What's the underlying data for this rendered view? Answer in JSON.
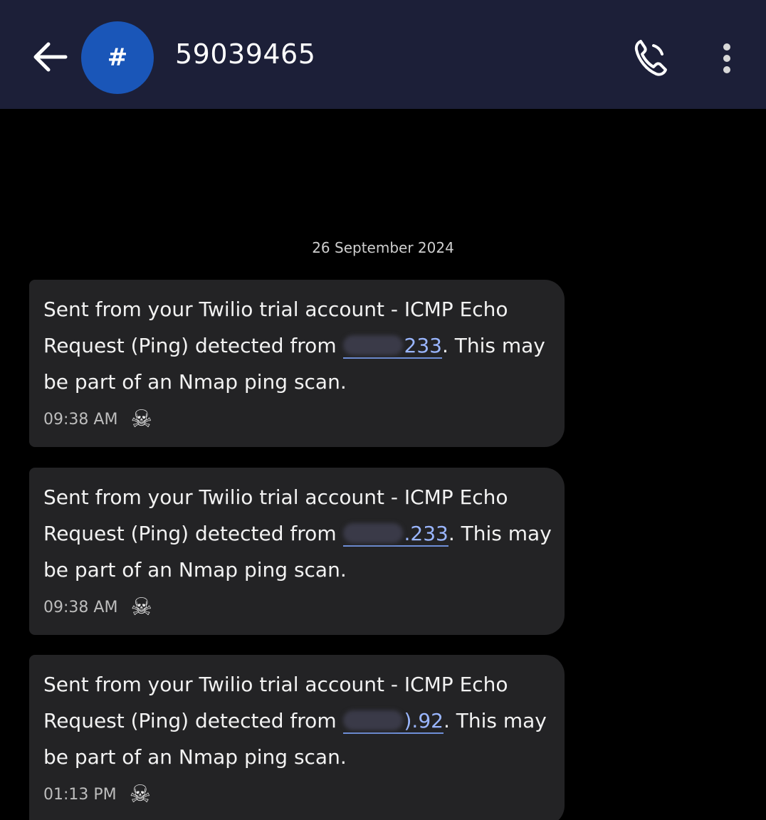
{
  "header": {
    "avatar_label": "#",
    "contact_number": "59039465"
  },
  "conversation": {
    "date_separator": "26 September 2024",
    "messages": [
      {
        "text_before": "Sent from your Twilio trial account - ICMP Echo Request (Ping) detected from ",
        "ip_visible": "233",
        "text_after": ". This may be part of an Nmap ping scan.",
        "time": "09:38 AM",
        "status_icon": "skull-crossbones-icon"
      },
      {
        "text_before": "Sent from your Twilio trial account - ICMP Echo Request (Ping) detected from ",
        "ip_visible": ".233",
        "text_after": ". This may be part of an Nmap ping scan.",
        "time": "09:38 AM",
        "status_icon": "skull-crossbones-icon"
      },
      {
        "text_before": "Sent from your Twilio trial account - ICMP Echo Request (Ping) detected from ",
        "ip_visible": ").92",
        "text_after": ". This may be part of an Nmap ping scan.",
        "time": "01:13 PM",
        "status_icon": "skull-crossbones-icon"
      }
    ]
  },
  "colors": {
    "header_bg": "#1c1f38",
    "avatar_bg": "#1a56b8",
    "bubble_bg": "#232325",
    "link": "#9ab6ff"
  }
}
